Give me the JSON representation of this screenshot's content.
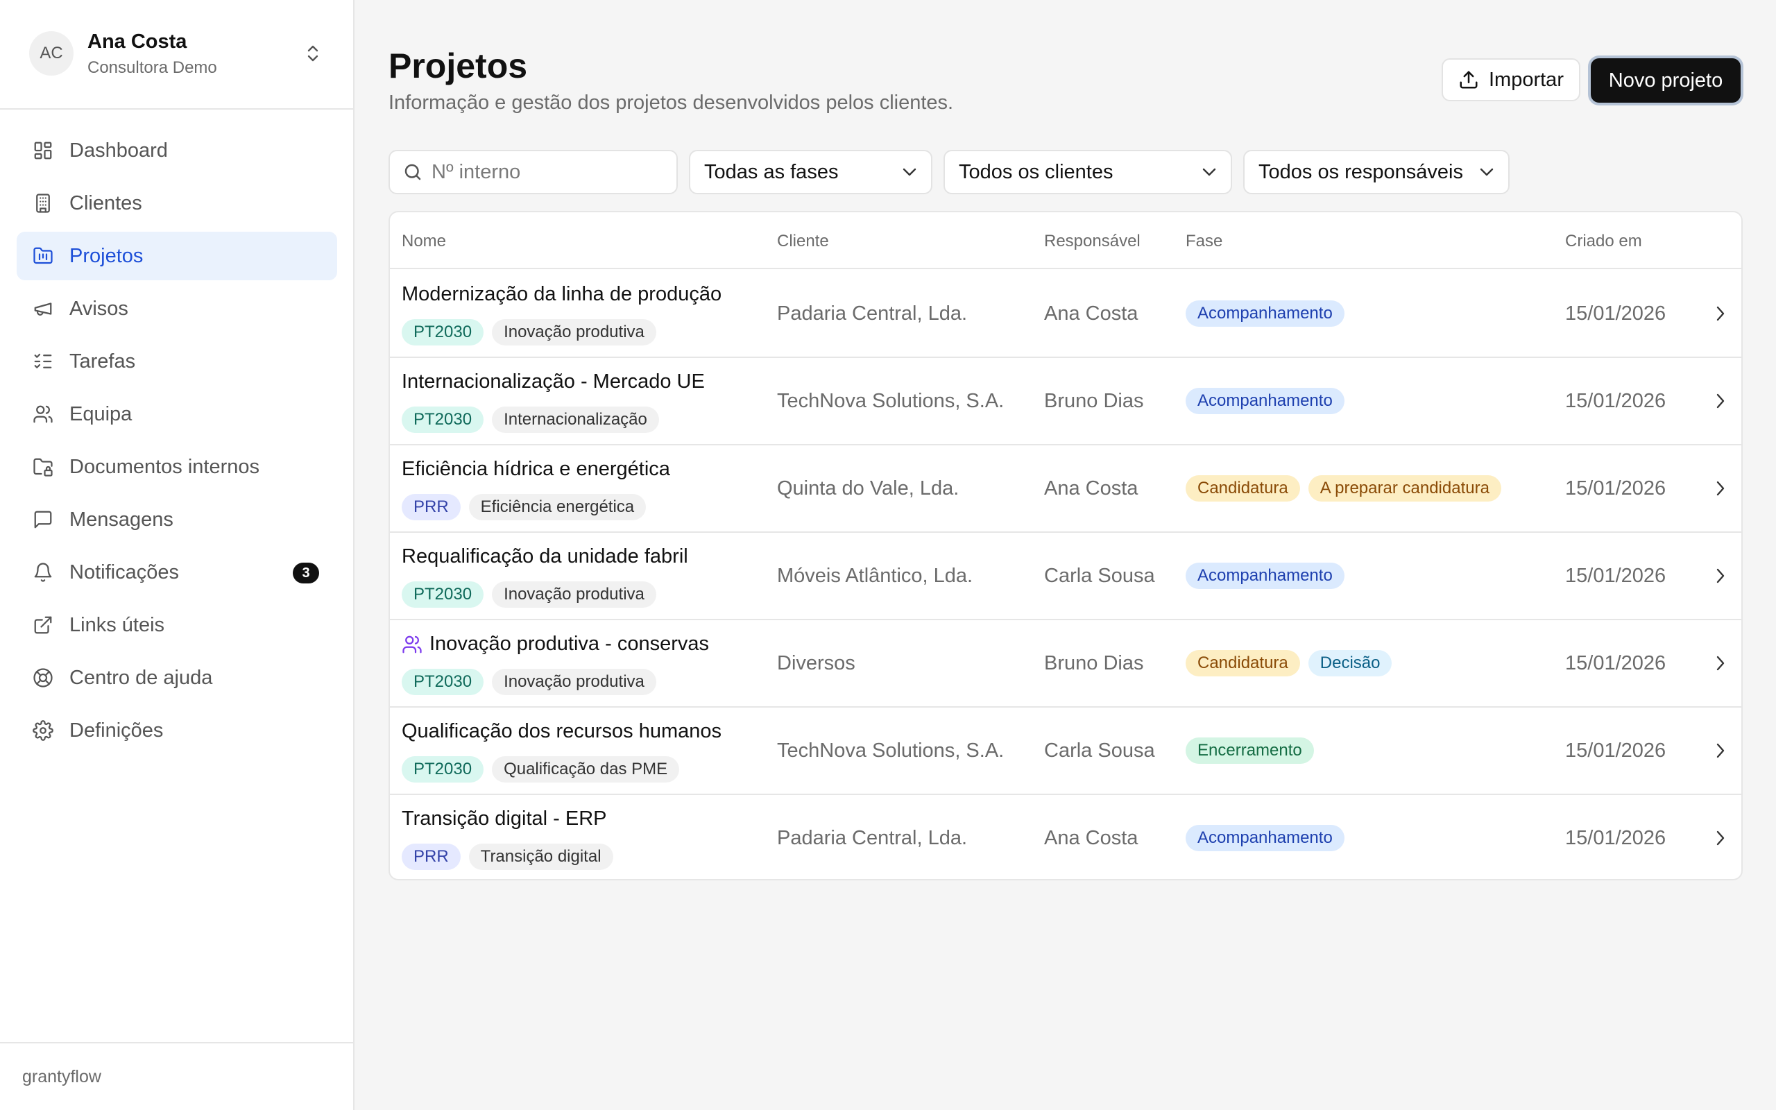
{
  "account": {
    "initials": "AC",
    "name": "Ana Costa",
    "role": "Consultora Demo"
  },
  "nav": [
    {
      "label": "Dashboard",
      "icon": "dashboard-icon"
    },
    {
      "label": "Clientes",
      "icon": "building-icon"
    },
    {
      "label": "Projetos",
      "icon": "folder-icon",
      "active": true
    },
    {
      "label": "Avisos",
      "icon": "megaphone-icon"
    },
    {
      "label": "Tarefas",
      "icon": "checklist-icon"
    },
    {
      "label": "Equipa",
      "icon": "users-icon"
    },
    {
      "label": "Documentos internos",
      "icon": "folder-lock-icon"
    },
    {
      "label": "Mensagens",
      "icon": "message-icon"
    },
    {
      "label": "Notificações",
      "icon": "bell-icon",
      "badge": "3"
    },
    {
      "label": "Links úteis",
      "icon": "external-link-icon"
    },
    {
      "label": "Centro de ajuda",
      "icon": "lifebuoy-icon"
    },
    {
      "label": "Definições",
      "icon": "gear-icon"
    }
  ],
  "footer": {
    "brand": "grantyflow"
  },
  "header": {
    "title": "Projetos",
    "subtitle": "Informação e gestão dos projetos desenvolvidos pelos clientes.",
    "import_label": "Importar",
    "new_label": "Novo projeto"
  },
  "filters": {
    "search_placeholder": "Nº interno",
    "phase": "Todas as fases",
    "client": "Todos os clientes",
    "owner": "Todos os responsáveis"
  },
  "table": {
    "columns": {
      "name": "Nome",
      "client": "Cliente",
      "owner": "Responsável",
      "phase": "Fase",
      "created": "Criado em"
    },
    "rows": [
      {
        "name": "Modernização da linha de produção",
        "program": "PT2030",
        "program_type": "pt",
        "category": "Inovação produtiva",
        "client": "Padaria Central, Lda.",
        "owner": "Ana Costa",
        "phases": [
          {
            "label": "Acompanhamento",
            "color": "blue"
          }
        ],
        "created": "15/01/2026"
      },
      {
        "name": "Internacionalização - Mercado UE",
        "program": "PT2030",
        "program_type": "pt",
        "category": "Internacionalização",
        "client": "TechNova Solutions, S.A.",
        "owner": "Bruno Dias",
        "phases": [
          {
            "label": "Acompanhamento",
            "color": "blue"
          }
        ],
        "created": "15/01/2026"
      },
      {
        "name": "Eficiência hídrica e energética",
        "program": "PRR",
        "program_type": "prr",
        "category": "Eficiência energética",
        "client": "Quinta do Vale, Lda.",
        "owner": "Ana Costa",
        "phases": [
          {
            "label": "Candidatura",
            "color": "amber"
          },
          {
            "label": "A preparar candidatura",
            "color": "amber"
          }
        ],
        "created": "15/01/2026"
      },
      {
        "name": "Requalificação da unidade fabril",
        "program": "PT2030",
        "program_type": "pt",
        "category": "Inovação produtiva",
        "client": "Móveis Atlântico, Lda.",
        "owner": "Carla Sousa",
        "phases": [
          {
            "label": "Acompanhamento",
            "color": "blue"
          }
        ],
        "created": "15/01/2026"
      },
      {
        "name": "Inovação produtiva - conservas",
        "group": true,
        "program": "PT2030",
        "program_type": "pt",
        "category": "Inovação produtiva",
        "client": "Diversos",
        "owner": "Bruno Dias",
        "phases": [
          {
            "label": "Candidatura",
            "color": "amber"
          },
          {
            "label": "Decisão",
            "color": "sky"
          }
        ],
        "created": "15/01/2026"
      },
      {
        "name": "Qualificação dos recursos humanos",
        "program": "PT2030",
        "program_type": "pt",
        "category": "Qualificação das PME",
        "client": "TechNova Solutions, S.A.",
        "owner": "Carla Sousa",
        "phases": [
          {
            "label": "Encerramento",
            "color": "green"
          }
        ],
        "created": "15/01/2026"
      },
      {
        "name": "Transição digital - ERP",
        "program": "PRR",
        "program_type": "prr",
        "category": "Transição digital",
        "client": "Padaria Central, Lda.",
        "owner": "Ana Costa",
        "phases": [
          {
            "label": "Acompanhamento",
            "color": "blue"
          }
        ],
        "created": "15/01/2026"
      }
    ]
  }
}
